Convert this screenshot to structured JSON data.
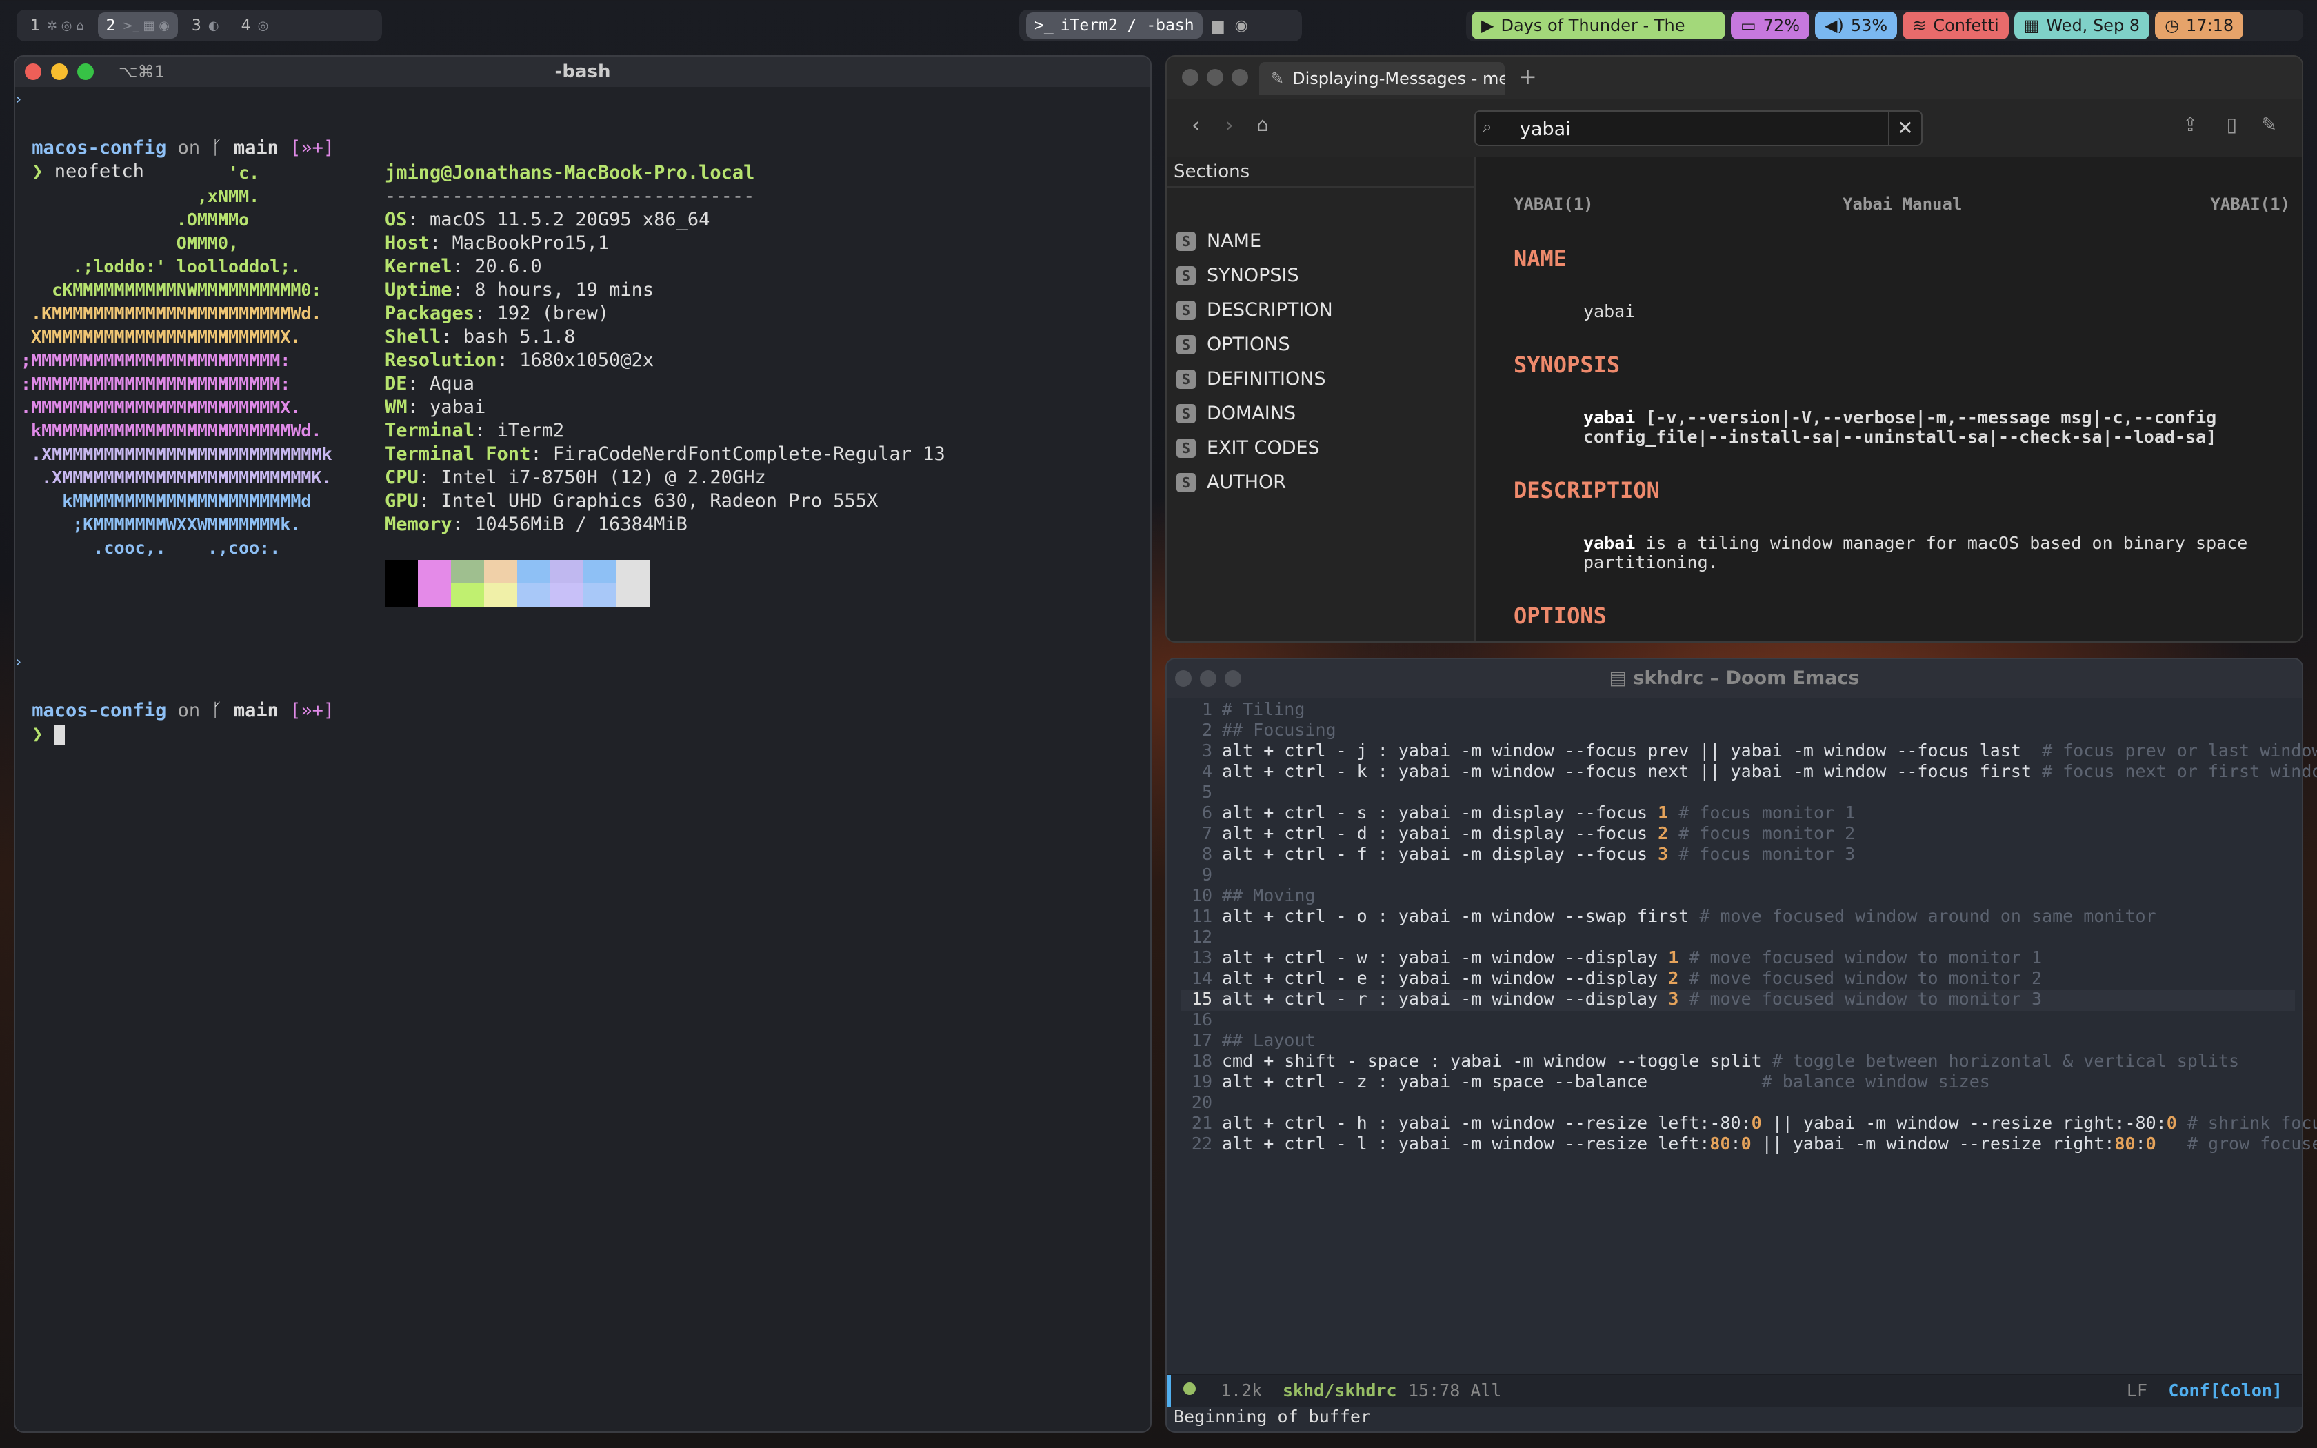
{
  "topbar": {
    "spaces": [
      {
        "num": "1",
        "icons": "✲ ◎ ⌂"
      },
      {
        "num": "2",
        "icons": ">_ ▦ ◉"
      },
      {
        "num": "3",
        "icons": "◐"
      },
      {
        "num": "4",
        "icons": "◎"
      }
    ],
    "active_app": "iTerm2 / -bash",
    "music": "Days of Thunder - The",
    "battery": "72%",
    "volume": "53%",
    "wifi": "Confetti",
    "date": "Wed, Sep 8",
    "time": "17:18",
    "colors": {
      "music": "#a3d87a",
      "battery": "#c678dd",
      "volume": "#7ab8f0",
      "wifi": "#e86b6b",
      "date": "#7fd1c8",
      "time": "#e6a36a"
    }
  },
  "terminal": {
    "title": "-bash",
    "shortcut": "⌥⌘1",
    "prompt_dir": "macos-config",
    "prompt_on": "on",
    "prompt_branch": "main",
    "prompt_status": "[»+]",
    "command": "neofetch",
    "arrow": "❯",
    "user_host": "jming@Jonathans-MacBook-Pro.local",
    "separator": "---------------------------------",
    "info": [
      {
        "key": "OS",
        "val": "macOS 11.5.2 20G95 x86_64"
      },
      {
        "key": "Host",
        "val": "MacBookPro15,1"
      },
      {
        "key": "Kernel",
        "val": "20.6.0"
      },
      {
        "key": "Uptime",
        "val": "8 hours, 19 mins"
      },
      {
        "key": "Packages",
        "val": "192 (brew)"
      },
      {
        "key": "Shell",
        "val": "bash 5.1.8"
      },
      {
        "key": "Resolution",
        "val": "1680x1050@2x"
      },
      {
        "key": "DE",
        "val": "Aqua"
      },
      {
        "key": "WM",
        "val": "yabai"
      },
      {
        "key": "Terminal",
        "val": "iTerm2"
      },
      {
        "key": "Terminal Font",
        "val": "FiraCodeNerdFontComplete-Regular 13"
      },
      {
        "key": "CPU",
        "val": "Intel i7-8750H (12) @ 2.20GHz"
      },
      {
        "key": "GPU",
        "val": "Intel UHD Graphics 630, Radeon Pro 555X"
      },
      {
        "key": "Memory",
        "val": "10456MiB / 16384MiB"
      }
    ],
    "logo": [
      {
        "t": "                    'c.",
        "c": "#b7e36f"
      },
      {
        "t": "                 ,xNMM.",
        "c": "#b7e36f"
      },
      {
        "t": "               .OMMMMo",
        "c": "#b7e36f"
      },
      {
        "t": "               OMMM0,",
        "c": "#b7e36f"
      },
      {
        "t": "     .;loddo:' loolloddol;.",
        "c": "#b7e36f"
      },
      {
        "t": "   cKMMMMMMMMMMNWMMMMMMMMMM0:",
        "c": "#b7e36f"
      },
      {
        "t": " .KMMMMMMMMMMMMMMMMMMMMMMMWd.",
        "c": "#f0c674"
      },
      {
        "t": " XMMMMMMMMMMMMMMMMMMMMMMMX.",
        "c": "#f0c674"
      },
      {
        "t": ";MMMMMMMMMMMMMMMMMMMMMMMM:",
        "c": "#e08ae8"
      },
      {
        "t": ":MMMMMMMMMMMMMMMMMMMMMMMM:",
        "c": "#e08ae8"
      },
      {
        "t": ".MMMMMMMMMMMMMMMMMMMMMMMMX.",
        "c": "#e08ae8"
      },
      {
        "t": " kMMMMMMMMMMMMMMMMMMMMMMMMWd.",
        "c": "#e08ae8"
      },
      {
        "t": " .XMMMMMMMMMMMMMMMMMMMMMMMMMMk",
        "c": "#c8b8f0"
      },
      {
        "t": "  .XMMMMMMMMMMMMMMMMMMMMMMMMK.",
        "c": "#c8b8f0"
      },
      {
        "t": "    kMMMMMMMMMMMMMMMMMMMMMMd",
        "c": "#8ec0f5"
      },
      {
        "t": "     ;KMMMMMMMWXXWMMMMMMMk.",
        "c": "#8ec0f5"
      },
      {
        "t": "       .cooc,.    .,coo:.",
        "c": "#8ec0f5"
      }
    ],
    "palette_top": [
      "#000000",
      "#e48ae8",
      "#9fbf8f",
      "#f0d0a8",
      "#8ec0f5",
      "#c0b8f0",
      "#8ec0f5",
      "#e0e0e0"
    ],
    "palette_bottom": [
      "#000000",
      "#e48ae8",
      "#c0f070",
      "#f0f0a8",
      "#a8c8f8",
      "#c8c0f8",
      "#a8c8f8",
      "#e0e0e0"
    ]
  },
  "manual": {
    "tab_title": "Displaying-Messages - me",
    "search_value": "yabai",
    "sections_label": "Sections",
    "section_icon": "S",
    "sections": [
      "NAME",
      "SYNOPSIS",
      "DESCRIPTION",
      "OPTIONS",
      "DEFINITIONS",
      "DOMAINS",
      "EXIT CODES",
      "AUTHOR"
    ],
    "header_left": "YABAI(1)",
    "header_center": "Yabai Manual",
    "header_right": "YABAI(1)",
    "h_name": "NAME",
    "name_text": "yabai",
    "h_synopsis": "SYNOPSIS",
    "synopsis_cmd": "yabai",
    "synopsis_line1": " [-v,--version|-V,--verbose|-m,--message msg|-c,--config",
    "synopsis_line2": "config_file|--install-sa|--uninstall-sa|--check-sa|--load-sa]",
    "h_description": "DESCRIPTION",
    "desc_bold": "yabai",
    "desc_line1": " is a tiling window manager for macOS based on binary space",
    "desc_line2": "partitioning.",
    "h_options": "OPTIONS"
  },
  "emacs": {
    "title": "skhdrc – Doom Emacs",
    "lines": [
      {
        "n": "1",
        "html": "<span class='c'># Tiling</span>"
      },
      {
        "n": "2",
        "html": "<span class='c'>## Focusing</span>"
      },
      {
        "n": "3",
        "html": "alt + ctrl - j : yabai -m window --focus prev || yabai -m window --focus last  <span class='c'># focus prev or last window</span>"
      },
      {
        "n": "4",
        "html": "alt + ctrl - k : yabai -m window --focus next || yabai -m window --focus first <span class='c'># focus next or first window</span>"
      },
      {
        "n": "5",
        "html": ""
      },
      {
        "n": "6",
        "html": "alt + ctrl - s : yabai -m display --focus <span class='n'>1</span> <span class='c'># focus monitor 1</span>"
      },
      {
        "n": "7",
        "html": "alt + ctrl - d : yabai -m display --focus <span class='n'>2</span> <span class='c'># focus monitor 2</span>"
      },
      {
        "n": "8",
        "html": "alt + ctrl - f : yabai -m display --focus <span class='n'>3</span> <span class='c'># focus monitor 3</span>"
      },
      {
        "n": "9",
        "html": ""
      },
      {
        "n": "10",
        "html": "<span class='c'>## Moving</span>"
      },
      {
        "n": "11",
        "html": "alt + ctrl - o : yabai -m window --swap first <span class='c'># move focused window around on same monitor</span>"
      },
      {
        "n": "12",
        "html": ""
      },
      {
        "n": "13",
        "html": "alt + ctrl - w : yabai -m window --display <span class='n'>1</span> <span class='c'># move focused window to monitor 1</span>"
      },
      {
        "n": "14",
        "html": "alt + ctrl - e : yabai -m window --display <span class='n'>2</span> <span class='c'># move focused window to monitor 2</span>"
      },
      {
        "n": "15",
        "html": "alt + ctrl - r : yabai -m window --display <span class='n'>3</span> <span class='c'># move focused window to monitor 3</span>"
      },
      {
        "n": "16",
        "html": ""
      },
      {
        "n": "17",
        "html": "<span class='c'>## Layout</span>"
      },
      {
        "n": "18",
        "html": "cmd + shift - space : yabai -m window --toggle split <span class='c'># toggle between horizontal &amp; vertical splits</span>"
      },
      {
        "n": "19",
        "html": "alt + ctrl - z : yabai -m space --balance           <span class='c'># balance window sizes</span>"
      },
      {
        "n": "20",
        "html": ""
      },
      {
        "n": "21",
        "html": "alt + ctrl - h : yabai -m window --resize left:-80:<span class='n'>0</span> || yabai -m window --resize right:-80:<span class='n'>0</span> <span class='c'># shrink focused w</span>"
      },
      {
        "n": "22",
        "html": "alt + ctrl - l : yabai -m window --resize left:<span class='n'>80</span>:<span class='n'>0</span> || yabai -m window --resize right:<span class='n'>80</span>:<span class='n'>0</span>   <span class='c'># grow focused win</span>"
      }
    ],
    "current_line": "15",
    "status": {
      "size": "1.2k",
      "dir": "skhd/",
      "file": "skhdrc",
      "pos": "15:78 All",
      "eol": "LF",
      "mode": "Conf[Colon]"
    },
    "minibuffer": "Beginning of buffer"
  }
}
